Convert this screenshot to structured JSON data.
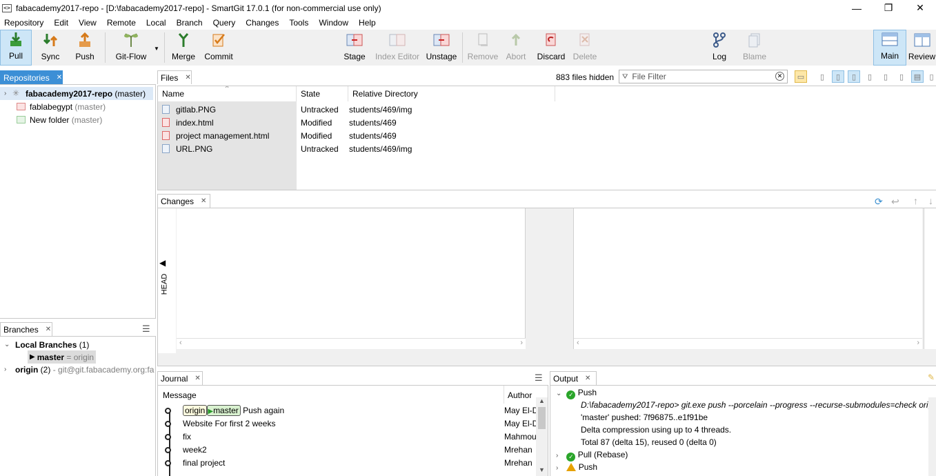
{
  "window": {
    "title": "fabacademy2017-repo - [D:\\fabacademy2017-repo] - SmartGit 17.0.1 (for non-commercial use only)",
    "minimize": "—",
    "restore": "❐",
    "close": "✕"
  },
  "menu": [
    "Repository",
    "Edit",
    "View",
    "Remote",
    "Local",
    "Branch",
    "Query",
    "Changes",
    "Tools",
    "Window",
    "Help"
  ],
  "toolbar": {
    "pull": "Pull",
    "sync": "Sync",
    "push": "Push",
    "gitflow": "Git-Flow",
    "merge": "Merge",
    "commit": "Commit",
    "stage": "Stage",
    "index_editor": "Index Editor",
    "unstage": "Unstage",
    "remove": "Remove",
    "abort": "Abort",
    "discard": "Discard",
    "delete": "Delete",
    "log": "Log",
    "blame": "Blame",
    "main": "Main",
    "review": "Review"
  },
  "repositories": {
    "tab": "Repositories",
    "items": [
      {
        "name": "fabacademy2017-repo",
        "branch": "(master)"
      },
      {
        "name": "fablabegypt",
        "branch": "(master)"
      },
      {
        "name": "New folder",
        "branch": "(master)"
      }
    ]
  },
  "files": {
    "tab": "Files",
    "hidden": "883 files hidden",
    "filter_placeholder": "File Filter",
    "columns": [
      "Name",
      "State",
      "Relative Directory"
    ],
    "rows": [
      {
        "name": "gitlab.PNG",
        "state": "Untracked",
        "dir": "students/469/img"
      },
      {
        "name": "index.html",
        "state": "Modified",
        "dir": "students/469"
      },
      {
        "name": "project management.html",
        "state": "Modified",
        "dir": "students/469"
      },
      {
        "name": "URL.PNG",
        "state": "Untracked",
        "dir": "students/469/img"
      }
    ]
  },
  "changes": {
    "tab": "Changes",
    "head_label": "HEAD"
  },
  "branches": {
    "tab": "Branches",
    "local_group": "Local Branches",
    "local_count": "(1)",
    "master": "master",
    "master_tracking": "= origin",
    "origin": "origin",
    "origin_count": "(2)",
    "origin_url": "- git@git.fabacademy.org:fa"
  },
  "journal": {
    "tab": "Journal",
    "col_message": "Message",
    "col_author": "Author",
    "ref_origin": "origin",
    "ref_master": "master",
    "rows": [
      {
        "message": "Push again",
        "author": "May El-D"
      },
      {
        "message": "Website For first 2 weeks",
        "author": "May El-D"
      },
      {
        "message": "fix",
        "author": "Mahmou"
      },
      {
        "message": "week2",
        "author": "Mrehan"
      },
      {
        "message": "final project",
        "author": "Mrehan"
      }
    ]
  },
  "output": {
    "tab": "Output",
    "push1": "Push",
    "cmd": "D:\\fabacademy2017-repo> git.exe push --porcelain --progress --recurse-submodules=check orig",
    "line1": "'master' pushed: 7f96875..e1f91be",
    "line2": "Delta compression using up to 4 threads.",
    "line3": "Total 87 (delta 15), reused 0 (delta 0)",
    "pull": "Pull (Rebase)",
    "push2": "Push"
  }
}
